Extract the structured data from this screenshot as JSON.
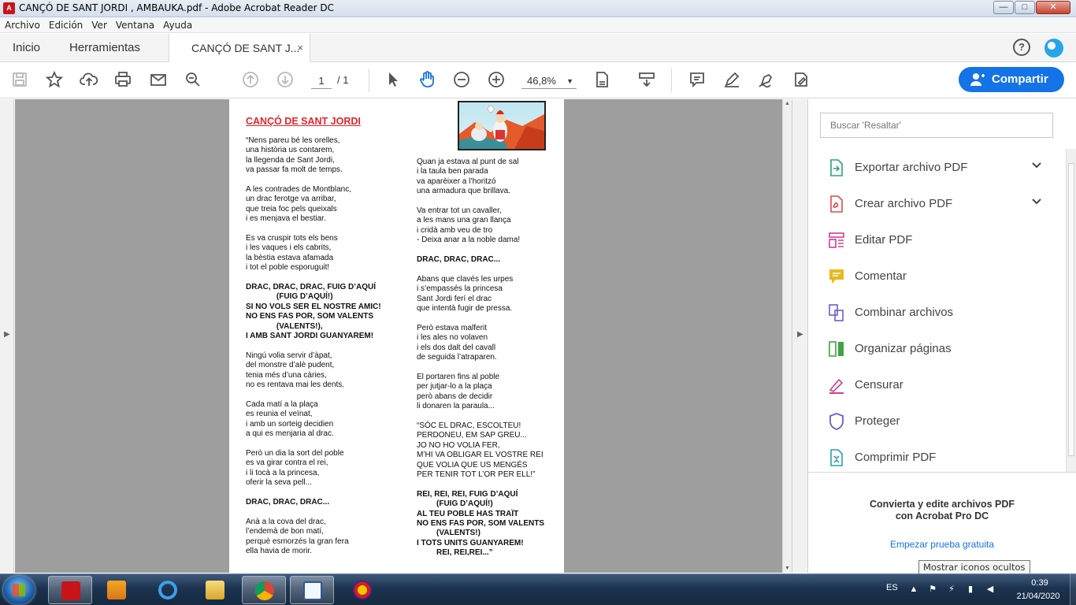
{
  "window": {
    "title": "CANÇÓ DE SANT JORDI , AMBAUKA.pdf - Adobe Acrobat Reader DC",
    "controls": {
      "minimize": "—",
      "maximize": "□",
      "close": "✕"
    }
  },
  "menubar": [
    "Archivo",
    "Edición",
    "Ver",
    "Ventana",
    "Ayuda"
  ],
  "tabs": {
    "home": "Inicio",
    "tools": "Herramientas",
    "document": "CANÇÓ DE SANT J...",
    "close": "×"
  },
  "header_icons": {
    "help": "?"
  },
  "toolbar": {
    "page_current": "1",
    "page_total": "/ 1",
    "zoom": "46,8%",
    "zoom_caret": "▼",
    "share_label": "Compartir",
    "icons": [
      "save-icon",
      "star-icon",
      "upload-icon",
      "print-icon",
      "mail-icon",
      "search-icon",
      "page-up-icon",
      "page-down-icon",
      "select-arrow-icon",
      "hand-icon",
      "zoom-out-icon",
      "zoom-in-icon",
      "fit-page-icon",
      "scroll-mode-icon",
      "comment-icon",
      "pen-icon",
      "sign-icon",
      "fill-sign-icon"
    ]
  },
  "document": {
    "title": "CANÇÓ DE SANT JORDI",
    "left_column": [
      {
        "bold": false,
        "lines": [
          "“Nens pareu bé les orelles,",
          "una història us contarem,",
          "la llegenda de Sant Jordi,",
          "va passar fa molt de temps."
        ]
      },
      {
        "bold": false,
        "lines": [
          "A les contrades de Montblanc,",
          "un drac ferotge va arribar,",
          "que treia foc pels queixals",
          "i es menjava el bestiar."
        ]
      },
      {
        "bold": false,
        "lines": [
          "Es va cruspir tots els bens",
          "i les vaques i els cabrits,",
          "la bèstia estava afamada",
          "i tot el poble esporuguit!"
        ]
      },
      {
        "bold": true,
        "lines": [
          "DRAC, DRAC, DRAC, FUIG D’AQUÍ",
          "              (FUIG D’AQUÍ!)",
          "SI NO VOLS SER EL NOSTRE AMIC!",
          "NO ENS FAS POR, SOM VALENTS",
          "              (VALENTS!),",
          "I AMB SANT JORDI GUANYAREM!"
        ]
      },
      {
        "bold": false,
        "lines": [
          "Ningú volia servir d’àpat,",
          "del monstre d’alè pudent,",
          "tenia més d’una càries,",
          "no es rentava mai les dents."
        ]
      },
      {
        "bold": false,
        "lines": [
          "Cada matí a la plaça",
          "es reunia el veïnat,",
          "i amb un sorteig decidien",
          "a qui es menjaria al drac."
        ]
      },
      {
        "bold": false,
        "lines": [
          "Però un dia la sort del poble",
          "es va girar contra el rei,",
          "i li tocà a la princesa,",
          "oferir la seva pell..."
        ]
      },
      {
        "bold": true,
        "lines": [
          "DRAC, DRAC, DRAC..."
        ]
      },
      {
        "bold": false,
        "lines": [
          "Anà a la cova del drac,",
          "l’endemà de bon matí,",
          "perquè esmorzés la gran fera",
          "ella havia de morir."
        ]
      }
    ],
    "right_column": [
      {
        "bold": false,
        "lines": [
          "Quan ja estava al punt de sal",
          "i la taula ben parada",
          "va aparèixer a l’horitzó",
          "una armadura que brillava."
        ]
      },
      {
        "bold": false,
        "lines": [
          "Va entrar tot un cavaller,",
          "a les mans una gran llança",
          "i cridà amb veu de tro",
          "- Deixa anar a la noble dama!"
        ]
      },
      {
        "bold": true,
        "lines": [
          "DRAC, DRAC, DRAC..."
        ]
      },
      {
        "bold": false,
        "lines": [
          "Abans que clavés les urpes",
          "i s’empassés la princesa",
          "Sant Jordi ferí el drac",
          "que intentà fugir de pressa."
        ]
      },
      {
        "bold": false,
        "lines": [
          "Però estava malferit",
          "i les ales no volaven",
          "i els dos dalt del cavall",
          "de seguida l’atraparen."
        ]
      },
      {
        "bold": false,
        "lines": [
          "El portaren fins al poble",
          "per jutjar-lo a la plaça",
          "però abans de decidir",
          "li donaren la paraula..."
        ]
      },
      {
        "bold": false,
        "lines": [
          "“SÓC EL DRAC, ESCOLTEU!",
          "PERDONEU, EM SAP GREU...",
          "JO NO HO VOLIA FER,",
          "M’HI VA OBLIGAR EL VOSTRE REI",
          "QUE VOLIA QUE US MENGÉS",
          "PER TENIR TOT L’OR PER ELL!”"
        ]
      },
      {
        "bold": true,
        "lines": [
          "REI, REI, REI, FUIG D’AQUÍ",
          "         (FUIG D’AQUÍ!)",
          "AL TEU POBLE HAS TRAÏT",
          "NO ENS FAS POR, SOM VALENTS",
          "         (VALENTS!)",
          "I TOTS UNITS GUANYAREM!",
          "         REI, REI,REI...”"
        ]
      }
    ]
  },
  "right_panel": {
    "search_placeholder": "Buscar 'Resaltar'",
    "tools": [
      {
        "label": "Exportar archivo PDF",
        "icon": "export-pdf-icon",
        "color": "#2ba07e",
        "expandable": true
      },
      {
        "label": "Crear archivo PDF",
        "icon": "create-pdf-icon",
        "color": "#e34850",
        "expandable": true
      },
      {
        "label": "Editar PDF",
        "icon": "edit-pdf-icon",
        "color": "#d23f8f",
        "expandable": false
      },
      {
        "label": "Comentar",
        "icon": "comment-icon",
        "color": "#e8b920",
        "expandable": false
      },
      {
        "label": "Combinar archivos",
        "icon": "combine-files-icon",
        "color": "#6c5ccf",
        "expandable": false
      },
      {
        "label": "Organizar páginas",
        "icon": "organize-pages-icon",
        "color": "#3fa43f",
        "expandable": false
      },
      {
        "label": "Censurar",
        "icon": "redact-icon",
        "color": "#d23f8f",
        "expandable": false
      },
      {
        "label": "Proteger",
        "icon": "protect-icon",
        "color": "#6c5ccf",
        "expandable": false
      },
      {
        "label": "Comprimir PDF",
        "icon": "compress-pdf-icon",
        "color": "#2b9fa8",
        "expandable": false
      }
    ],
    "promo_line1": "Convierta y edite archivos PDF",
    "promo_line2": "con Acrobat Pro DC",
    "promo_link": "Empezar prueba gratuita",
    "tooltip": "Mostrar iconos ocultos"
  },
  "taskbar": {
    "apps": [
      "acrobat-icon",
      "media-player-icon",
      "internet-explorer-icon",
      "file-explorer-icon",
      "chrome-icon",
      "word-document-icon",
      "app-icon"
    ],
    "language": "ES",
    "time": "0:39",
    "date": "21/04/2020"
  },
  "colors": {
    "accent": "#1473e6",
    "title_red": "#e8252a",
    "doc_background": "#9e9e9e"
  }
}
